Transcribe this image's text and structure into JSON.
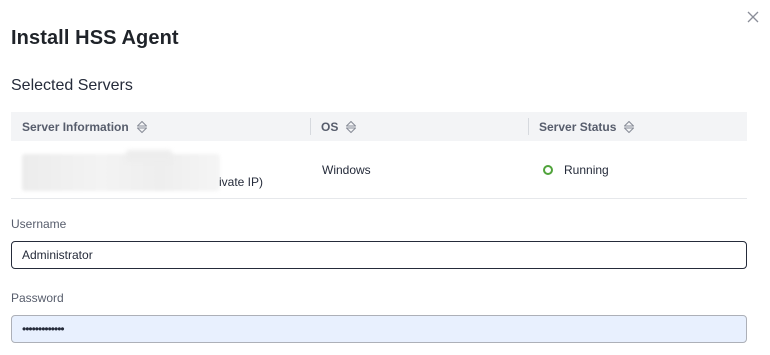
{
  "dialog": {
    "title": "Install HSS Agent",
    "close_icon": "close-icon"
  },
  "selected_servers": {
    "title": "Selected Servers",
    "columns": [
      {
        "label": "Server Information",
        "sort_icon": "sort-icon"
      },
      {
        "label": "OS",
        "sort_icon": "sort-icon"
      },
      {
        "label": "Server Status",
        "sort_icon": "sort-icon"
      }
    ],
    "rows": [
      {
        "server_info_suffix": "ivate IP)",
        "os": "Windows",
        "status": "Running",
        "status_color": "#50a33b"
      }
    ]
  },
  "form": {
    "username_label": "Username",
    "username_value": "Administrator",
    "password_label": "Password",
    "password_value": "•••••••••••••"
  }
}
